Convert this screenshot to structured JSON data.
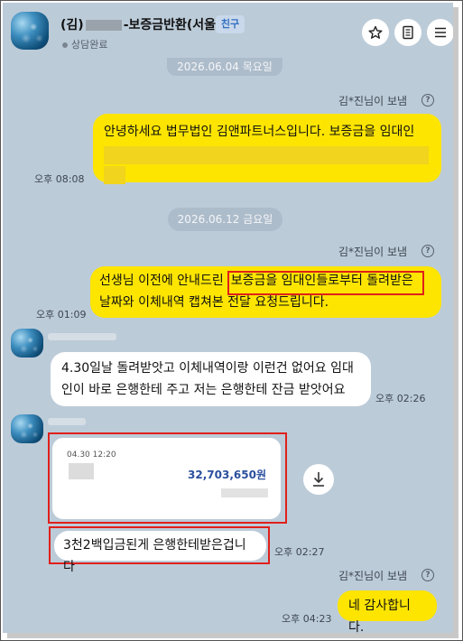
{
  "header": {
    "name_prefix": "(김)",
    "name_suffix": "-보증금반환(서울)",
    "friend_badge": "친구",
    "status": "상담완료",
    "icons": [
      "star-icon",
      "notebook-icon",
      "menu-icon"
    ]
  },
  "chat": {
    "date_top": "2026.06.04 목요일",
    "sent_by_1": "김*진님이 보냄",
    "msg1_line1": "안녕하세요 법무법인 김앤파트너스입니다. 보증금을 임대인",
    "msg1_time": "오후 08:08",
    "date_mid": "2026.06.12 금요일",
    "sent_by_2": "김*진님이 보냄",
    "msg2_line1_a": "선생님 이전에 안내드린",
    "msg2_line1_b": "보증금을 임대인들로부터 돌려받은",
    "msg2_line2": "날짜와 이체내역 캡쳐본 전달 요청드립니다.",
    "msg2_time": "오후 01:09",
    "reply1_line1": "4.30일날 돌려받앗고 이체내역이랑 이런건 없어요 임대",
    "reply1_line2": "인이 바로 은행한테 주고 저는 은행한테 잔금 받앗어요",
    "reply1_time": "오후 02:26",
    "card_datetime": "04.30 12:20",
    "card_amount": "32,703,650원",
    "reply2_text": "3천2백입금된게 은행한테받은겁니다",
    "reply2_time": "오후 02:27",
    "sent_by_3": "김*진님이 보냄",
    "msg3_text": "네 감사합니다.",
    "msg3_time": "오후 04:23"
  },
  "colors": {
    "background": "#bccbd8",
    "my_bubble": "#fde500",
    "their_bubble": "#ffffff",
    "highlight_box": "#e0201b",
    "badge_text": "#2f6fc2"
  }
}
